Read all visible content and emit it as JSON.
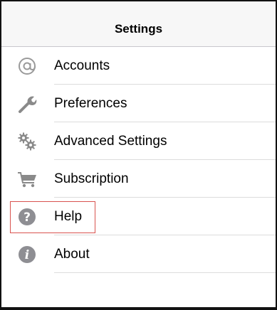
{
  "navbar": {
    "title": "Settings"
  },
  "items": [
    {
      "label": "Accounts",
      "icon": "at-sign-icon"
    },
    {
      "label": "Preferences",
      "icon": "wrench-icon"
    },
    {
      "label": "Advanced Settings",
      "icon": "gears-icon"
    },
    {
      "label": "Subscription",
      "icon": "cart-icon"
    },
    {
      "label": "Help",
      "icon": "question-icon"
    },
    {
      "label": "About",
      "icon": "info-icon"
    }
  ],
  "colors": {
    "highlight": "#d9534f",
    "icon_gray": "#8e8e93"
  }
}
